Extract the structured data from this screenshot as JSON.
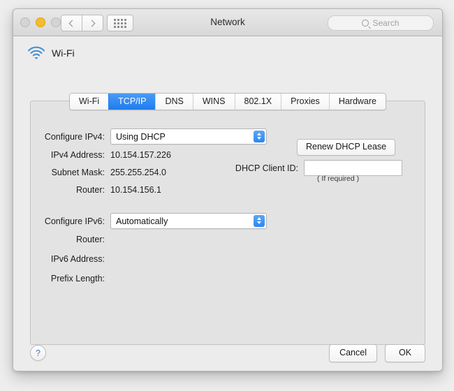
{
  "window": {
    "title": "Network",
    "traffic_lights": [
      "close",
      "minimize",
      "zoom"
    ],
    "nav_back_icon": "chevron-left-icon",
    "nav_forward_icon": "chevron-right-icon",
    "show_all_icon": "grid-icon",
    "search": {
      "placeholder": "Search",
      "value": "",
      "icon": "search-icon"
    }
  },
  "service": {
    "icon": "wifi-icon",
    "name": "Wi-Fi"
  },
  "tabs": [
    {
      "label": "Wi-Fi",
      "selected": false
    },
    {
      "label": "TCP/IP",
      "selected": true
    },
    {
      "label": "DNS",
      "selected": false
    },
    {
      "label": "WINS",
      "selected": false
    },
    {
      "label": "802.1X",
      "selected": false
    },
    {
      "label": "Proxies",
      "selected": false
    },
    {
      "label": "Hardware",
      "selected": false
    }
  ],
  "ipv4": {
    "configure_label": "Configure IPv4:",
    "configure_value": "Using DHCP",
    "address_label": "IPv4 Address:",
    "address_value": "10.154.157.226",
    "subnet_label": "Subnet Mask:",
    "subnet_value": "255.255.254.0",
    "router_label": "Router:",
    "router_value": "10.154.156.1"
  },
  "dhcp": {
    "renew_button": "Renew DHCP Lease",
    "client_id_label": "DHCP Client ID:",
    "client_id_value": "",
    "hint": "( If required )"
  },
  "ipv6": {
    "configure_label": "Configure IPv6:",
    "configure_value": "Automatically",
    "router_label": "Router:",
    "router_value": "",
    "address_label": "IPv6 Address:",
    "address_value": "",
    "prefix_label": "Prefix Length:",
    "prefix_value": ""
  },
  "footer": {
    "help_label": "?",
    "cancel_label": "Cancel",
    "ok_label": "OK"
  },
  "colors": {
    "accent_blue": "#1f7cef",
    "wifi_blue": "#3d86c6",
    "minimize_yellow": "#f6bc2f",
    "window_bg": "#ececec",
    "panel_bg": "#e3e3e3"
  }
}
